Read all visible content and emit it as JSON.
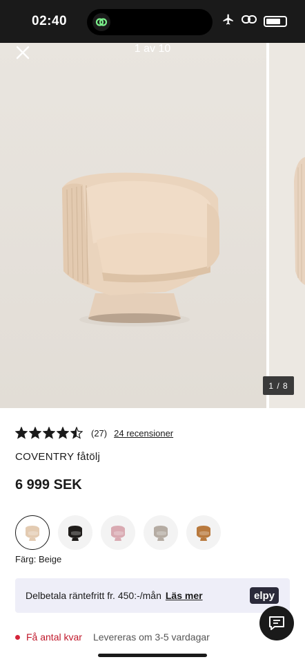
{
  "status_bar": {
    "time": "02:40"
  },
  "gallery": {
    "counter": "1 av 10",
    "photo_counter": "1 / 8",
    "close_icon": "close-icon"
  },
  "product": {
    "rating": 4.5,
    "rating_max": 5,
    "review_count": "(27)",
    "reviews_link": "24 recensioner",
    "name": "COVENTRY fåtölj",
    "price": "6 999 SEK",
    "color_label": "Färg: Beige",
    "swatches": [
      {
        "name": "Beige",
        "color": "#e3cbb2"
      },
      {
        "name": "Black",
        "color": "#1f1c1a"
      },
      {
        "name": "Pink",
        "color": "#d9aab2"
      },
      {
        "name": "Grey",
        "color": "#b5aca3"
      },
      {
        "name": "Cognac",
        "color": "#b97a3e"
      }
    ]
  },
  "payment": {
    "text": "Delbetala räntefritt fr. 450:-/mån",
    "link": "Läs mer",
    "logo": "elpy"
  },
  "stock": {
    "status": "Få antal kvar",
    "delivery": "Levereras om 3-5 vardagar",
    "status_color": "#c0182b"
  },
  "colors": {
    "accent": "#1a1a1a",
    "banner_bg": "#eeeef8"
  }
}
